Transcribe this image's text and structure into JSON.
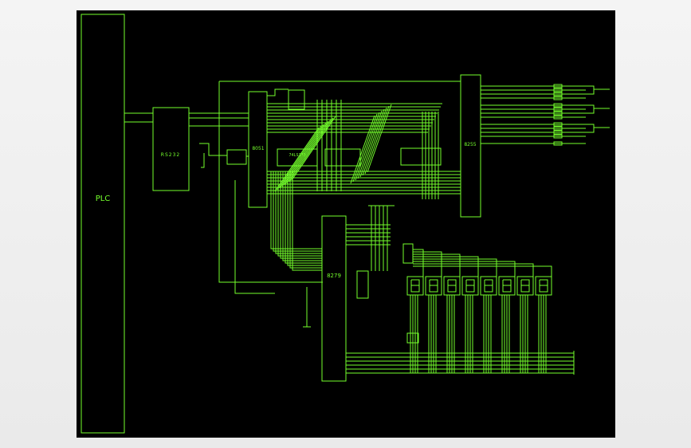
{
  "colors": {
    "background": "#000000",
    "wire": "#74ff2c",
    "frame": "#eeeeee"
  },
  "blocks": {
    "plc": "PLC",
    "rs232": "RS232",
    "mcu": "8051",
    "kbd": "8279",
    "ppi": "8255",
    "latch": "74LS373"
  },
  "digits": [
    "8",
    "8",
    "8",
    "8",
    "8",
    "8",
    "8",
    "8"
  ]
}
